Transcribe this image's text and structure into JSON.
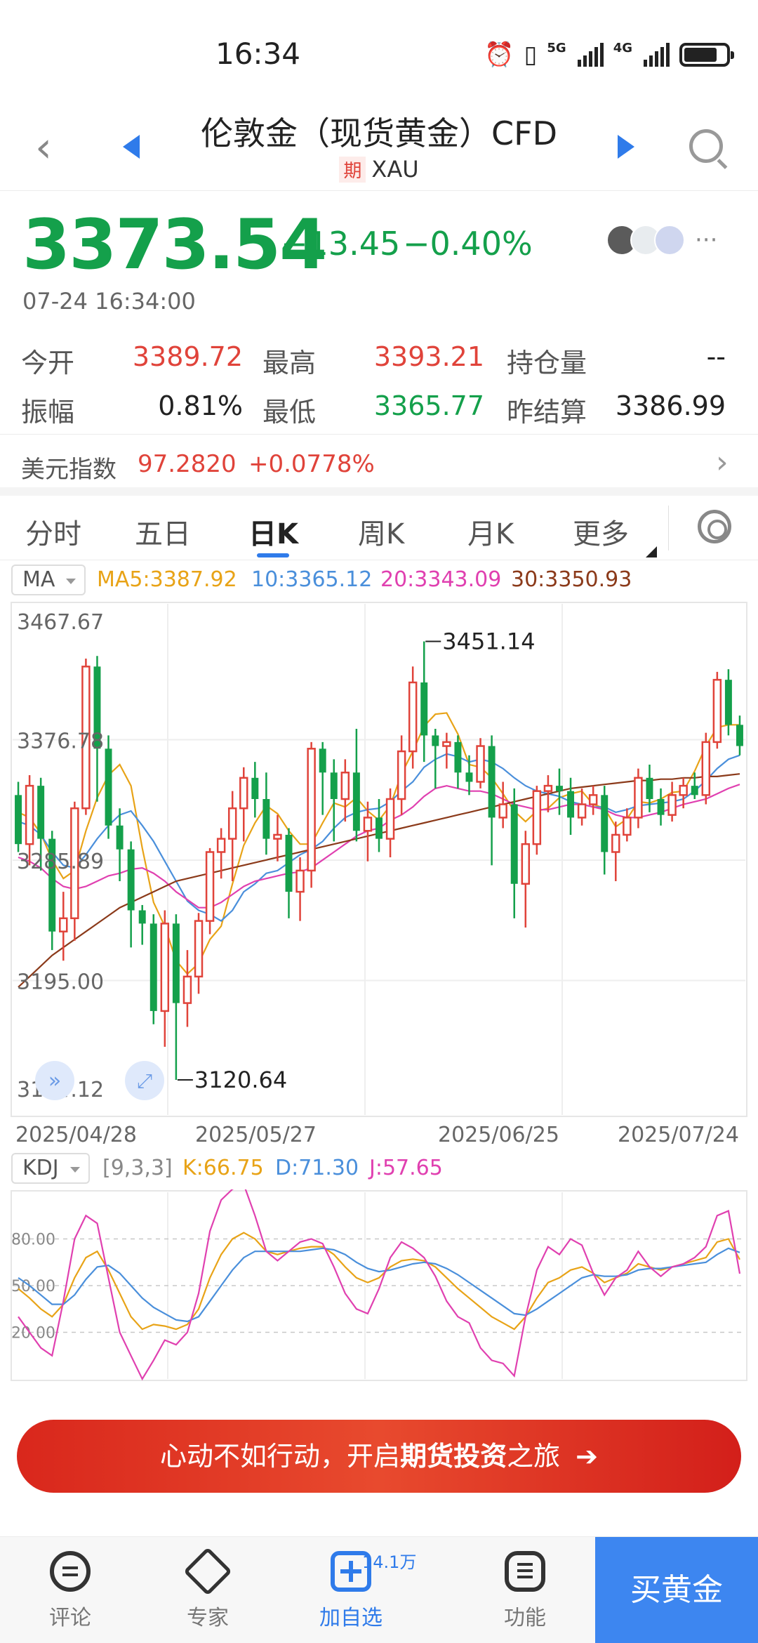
{
  "status_bar": {
    "time": "16:34",
    "net1": "5G",
    "net2": "4G"
  },
  "header": {
    "title": "伦敦金（现货黄金）CFD",
    "tag": "期",
    "symbol": "XAU"
  },
  "quote": {
    "price": "3373.54",
    "change": "−13.45",
    "change_pct": "−0.40%",
    "timestamp": "07-24 16:34:00",
    "more": "···"
  },
  "stats": {
    "open_label": "今开",
    "open": "3389.72",
    "high_label": "最高",
    "high": "3393.21",
    "oi_label": "持仓量",
    "oi": "--",
    "amp_label": "振幅",
    "amp": "0.81%",
    "low_label": "最低",
    "low": "3365.77",
    "prev_label": "昨结算",
    "prev": "3386.99"
  },
  "index": {
    "label": "美元指数",
    "value": "97.2820",
    "change": "+0.0778%"
  },
  "tabs": [
    "分时",
    "五日",
    "日K",
    "周K",
    "月K",
    "更多"
  ],
  "ma": {
    "button": "MA",
    "ma5": "MA5:3387.92",
    "ma10": "10:3365.12",
    "ma20": "20:3343.09",
    "ma30": "30:3350.93",
    "colors": {
      "ma5": "#e8a317",
      "ma10": "#4a8fdb",
      "ma20": "#e040b0",
      "ma30": "#8b3a1a"
    }
  },
  "kdj": {
    "button": "KDJ",
    "params": "[9,3,3]",
    "k": "K:66.75",
    "d": "D:71.30",
    "j": "J:57.65",
    "levels": [
      "80.00",
      "50.00",
      "20.00"
    ]
  },
  "chart_data": [
    {
      "type": "candlestick",
      "y_ticks": [
        "3467.67",
        "3376.78",
        "3285.89",
        "3195.00",
        "3104.12"
      ],
      "ylim": [
        3104.12,
        3467.67
      ],
      "x_ticks": [
        "2025/04/28",
        "2025/05/27",
        "2025/06/25",
        "2025/07/24"
      ],
      "annotations": {
        "max": "3451.14",
        "min": "3120.64"
      },
      "candles": [
        [
          3335,
          3298,
          3345,
          3292
        ],
        [
          3298,
          3342,
          3350,
          3282
        ],
        [
          3342,
          3302,
          3348,
          3278
        ],
        [
          3302,
          3232,
          3308,
          3218
        ],
        [
          3232,
          3242,
          3262,
          3210
        ],
        [
          3242,
          3325,
          3330,
          3225
        ],
        [
          3325,
          3432,
          3438,
          3320
        ],
        [
          3432,
          3370,
          3440,
          3330
        ],
        [
          3370,
          3312,
          3380,
          3302
        ],
        [
          3312,
          3294,
          3325,
          3270
        ],
        [
          3294,
          3248,
          3300,
          3220
        ],
        [
          3248,
          3238,
          3252,
          3222
        ],
        [
          3238,
          3172,
          3245,
          3162
        ],
        [
          3172,
          3238,
          3248,
          3145
        ],
        [
          3238,
          3178,
          3245,
          3120
        ],
        [
          3178,
          3198,
          3218,
          3160
        ],
        [
          3198,
          3240,
          3246,
          3185
        ],
        [
          3240,
          3292,
          3295,
          3230
        ],
        [
          3292,
          3302,
          3310,
          3272
        ],
        [
          3302,
          3325,
          3338,
          3270
        ],
        [
          3325,
          3348,
          3356,
          3300
        ],
        [
          3348,
          3332,
          3360,
          3318
        ],
        [
          3332,
          3302,
          3352,
          3290
        ],
        [
          3302,
          3305,
          3320,
          3285
        ],
        [
          3305,
          3262,
          3310,
          3242
        ],
        [
          3262,
          3278,
          3288,
          3240
        ],
        [
          3278,
          3370,
          3375,
          3265
        ],
        [
          3370,
          3352,
          3375,
          3320
        ],
        [
          3352,
          3332,
          3362,
          3300
        ],
        [
          3332,
          3352,
          3362,
          3315
        ],
        [
          3352,
          3308,
          3385,
          3300
        ],
        [
          3308,
          3318,
          3330,
          3285
        ],
        [
          3318,
          3302,
          3332,
          3292
        ],
        [
          3302,
          3332,
          3340,
          3288
        ],
        [
          3332,
          3368,
          3380,
          3320
        ],
        [
          3368,
          3420,
          3432,
          3355
        ],
        [
          3420,
          3380,
          3451,
          3360
        ],
        [
          3380,
          3372,
          3385,
          3340
        ],
        [
          3372,
          3375,
          3382,
          3355
        ],
        [
          3375,
          3352,
          3380,
          3340
        ],
        [
          3352,
          3345,
          3365,
          3335
        ],
        [
          3345,
          3372,
          3378,
          3340
        ],
        [
          3372,
          3318,
          3380,
          3282
        ],
        [
          3318,
          3328,
          3345,
          3310
        ],
        [
          3328,
          3268,
          3340,
          3242
        ],
        [
          3268,
          3298,
          3308,
          3235
        ],
        [
          3298,
          3338,
          3342,
          3290
        ],
        [
          3338,
          3342,
          3350,
          3322
        ],
        [
          3342,
          3338,
          3355,
          3320
        ],
        [
          3338,
          3318,
          3348,
          3305
        ],
        [
          3318,
          3328,
          3340,
          3312
        ],
        [
          3328,
          3335,
          3342,
          3320
        ],
        [
          3335,
          3292,
          3342,
          3275
        ],
        [
          3292,
          3305,
          3315,
          3270
        ],
        [
          3305,
          3318,
          3325,
          3300
        ],
        [
          3318,
          3348,
          3355,
          3310
        ],
        [
          3348,
          3332,
          3358,
          3322
        ],
        [
          3332,
          3320,
          3340,
          3312
        ],
        [
          3320,
          3335,
          3345,
          3315
        ],
        [
          3335,
          3342,
          3348,
          3325
        ],
        [
          3342,
          3335,
          3352,
          3332
        ],
        [
          3335,
          3375,
          3382,
          3328
        ],
        [
          3375,
          3422,
          3428,
          3370
        ],
        [
          3422,
          3388,
          3430,
          3380
        ],
        [
          3388,
          3372,
          3395,
          3365
        ]
      ],
      "ma_series": [
        {
          "name": "MA5",
          "values": [
            3322,
            3318,
            3306,
            3286,
            3272,
            3278,
            3308,
            3333,
            3350,
            3358,
            3342,
            3295,
            3254,
            3236,
            3210,
            3200,
            3208,
            3226,
            3236,
            3268,
            3297,
            3314,
            3327,
            3321,
            3308,
            3298,
            3298,
            3314,
            3329,
            3326,
            3333,
            3323,
            3316,
            3327,
            3351,
            3368,
            3387,
            3396,
            3397,
            3381,
            3358,
            3356,
            3348,
            3336,
            3323,
            3315,
            3323,
            3325,
            3333,
            3336,
            3338,
            3328,
            3325,
            3311,
            3317,
            3330,
            3329,
            3332,
            3337,
            3338,
            3353,
            3372,
            3386,
            3388,
            3388
          ]
        },
        {
          "name": "MA10",
          "values": [
            3315,
            3312,
            3305,
            3292,
            3282,
            3280,
            3290,
            3302,
            3312,
            3320,
            3323,
            3312,
            3300,
            3285,
            3270,
            3255,
            3248,
            3245,
            3240,
            3248,
            3262,
            3268,
            3276,
            3278,
            3284,
            3290,
            3294,
            3300,
            3310,
            3318,
            3322,
            3324,
            3325,
            3330,
            3338,
            3345,
            3356,
            3362,
            3366,
            3364,
            3360,
            3362,
            3360,
            3355,
            3348,
            3342,
            3338,
            3336,
            3334,
            3330,
            3328,
            3326,
            3326,
            3322,
            3324,
            3327,
            3328,
            3329,
            3330,
            3332,
            3338,
            3346,
            3355,
            3362,
            3365
          ]
        },
        {
          "name": "MA20",
          "values": [
            3288,
            3285,
            3280,
            3272,
            3266,
            3264,
            3266,
            3270,
            3274,
            3276,
            3279,
            3280,
            3276,
            3270,
            3262,
            3256,
            3250,
            3250,
            3254,
            3260,
            3266,
            3270,
            3272,
            3274,
            3276,
            3277,
            3280,
            3286,
            3292,
            3298,
            3304,
            3308,
            3310,
            3316,
            3320,
            3326,
            3334,
            3340,
            3342,
            3340,
            3338,
            3338,
            3336,
            3332,
            3328,
            3326,
            3324,
            3324,
            3326,
            3328,
            3328,
            3326,
            3324,
            3320,
            3318,
            3318,
            3320,
            3322,
            3325,
            3328,
            3330,
            3332,
            3336,
            3340,
            3343
          ]
        },
        {
          "name": "MA30",
          "values": [
            3190,
            3198,
            3206,
            3214,
            3220,
            3226,
            3232,
            3238,
            3244,
            3250,
            3254,
            3258,
            3262,
            3266,
            3270,
            3272,
            3274,
            3276,
            3278,
            3280,
            3282,
            3284,
            3286,
            3288,
            3290,
            3292,
            3294,
            3296,
            3298,
            3300,
            3302,
            3304,
            3306,
            3308,
            3310,
            3312,
            3314,
            3316,
            3318,
            3320,
            3322,
            3324,
            3326,
            3328,
            3330,
            3332,
            3334,
            3336,
            3338,
            3340,
            3341,
            3342,
            3343,
            3344,
            3345,
            3346,
            3346,
            3347,
            3347,
            3348,
            3348,
            3349,
            3349,
            3350,
            3351
          ]
        }
      ]
    },
    {
      "type": "line",
      "ylim": [
        -10,
        110
      ],
      "series": [
        {
          "name": "K",
          "values": [
            48,
            42,
            35,
            30,
            38,
            55,
            68,
            72,
            60,
            45,
            30,
            22,
            25,
            24,
            22,
            25,
            35,
            55,
            70,
            80,
            84,
            80,
            72,
            70,
            72,
            74,
            75,
            75,
            70,
            62,
            55,
            52,
            55,
            62,
            66,
            67,
            66,
            62,
            55,
            48,
            42,
            36,
            30,
            26,
            22,
            30,
            42,
            52,
            55,
            60,
            62,
            58,
            52,
            55,
            58,
            64,
            62,
            60,
            62,
            64,
            66,
            68,
            78,
            80,
            66.75
          ]
        },
        {
          "name": "D",
          "values": [
            55,
            50,
            44,
            38,
            38,
            44,
            54,
            62,
            63,
            58,
            50,
            42,
            36,
            32,
            28,
            27,
            30,
            40,
            50,
            60,
            68,
            72,
            72,
            72,
            72,
            72,
            73,
            74,
            73,
            70,
            65,
            61,
            59,
            60,
            62,
            64,
            65,
            64,
            61,
            57,
            52,
            47,
            42,
            37,
            32,
            31,
            35,
            40,
            45,
            50,
            55,
            57,
            56,
            56,
            57,
            60,
            61,
            61,
            62,
            63,
            64,
            65,
            70,
            74,
            71.3
          ]
        },
        {
          "name": "J",
          "values": [
            30,
            20,
            10,
            5,
            40,
            80,
            95,
            90,
            55,
            20,
            5,
            -10,
            2,
            15,
            12,
            20,
            45,
            85,
            105,
            112,
            115,
            95,
            72,
            66,
            72,
            78,
            80,
            77,
            62,
            45,
            35,
            32,
            48,
            68,
            78,
            74,
            68,
            56,
            40,
            30,
            26,
            10,
            2,
            0,
            -8,
            30,
            60,
            75,
            70,
            80,
            76,
            58,
            44,
            55,
            60,
            72,
            62,
            56,
            62,
            64,
            68,
            75,
            95,
            98,
            57.65
          ]
        }
      ]
    }
  ],
  "banner": {
    "pre": "心动不如行动，开启",
    "bold": "期货投资",
    "post": "之旅",
    "arrow": "➔"
  },
  "bottom_nav": {
    "items": [
      "评论",
      "专家",
      "加自选",
      "功能"
    ],
    "badge": "14.1万",
    "buy": "买黄金"
  }
}
